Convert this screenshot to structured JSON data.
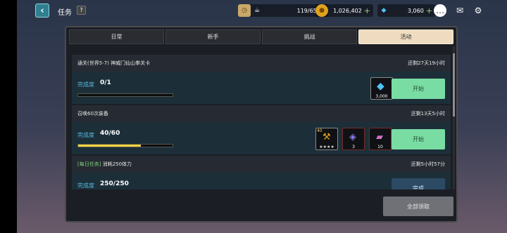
{
  "header": {
    "title": "任务",
    "help": "?",
    "stamina": "119/65",
    "gold": "1,026,402",
    "gems": "3,060"
  },
  "tabs": [
    "日常",
    "新手",
    "挑战",
    "活动"
  ],
  "active_tab_index": 3,
  "quests": [
    {
      "tag": "",
      "name": "通关(世界5-7) 神威门仙山拳关卡",
      "time": "还剩27天19小时",
      "progress_label": "完成度",
      "progress": "0/1",
      "fill": 0.0,
      "rewards": [
        {
          "icon": "gem-icon",
          "count": "3,000"
        }
      ],
      "button": "开始"
    },
    {
      "tag": "",
      "name": "召唤60次装备",
      "time": "还剩13天5小时",
      "progress_label": "完成度",
      "progress": "40/60",
      "fill": 0.667,
      "rewards": [
        {
          "icon": "axe-icon",
          "count": "★★★★",
          "level": "40"
        },
        {
          "icon": "crystal-icon",
          "count": "3"
        },
        {
          "icon": "ticket-icon",
          "count": "10"
        }
      ],
      "button": "开始"
    },
    {
      "tag": "[每日任务]",
      "name": " 消耗250体力",
      "time": "还剩5小时57分",
      "progress_label": "完成度",
      "progress": "250/250",
      "fill": 1.0,
      "rewards": [],
      "button": "完成"
    }
  ],
  "claim_all": "全部领取"
}
